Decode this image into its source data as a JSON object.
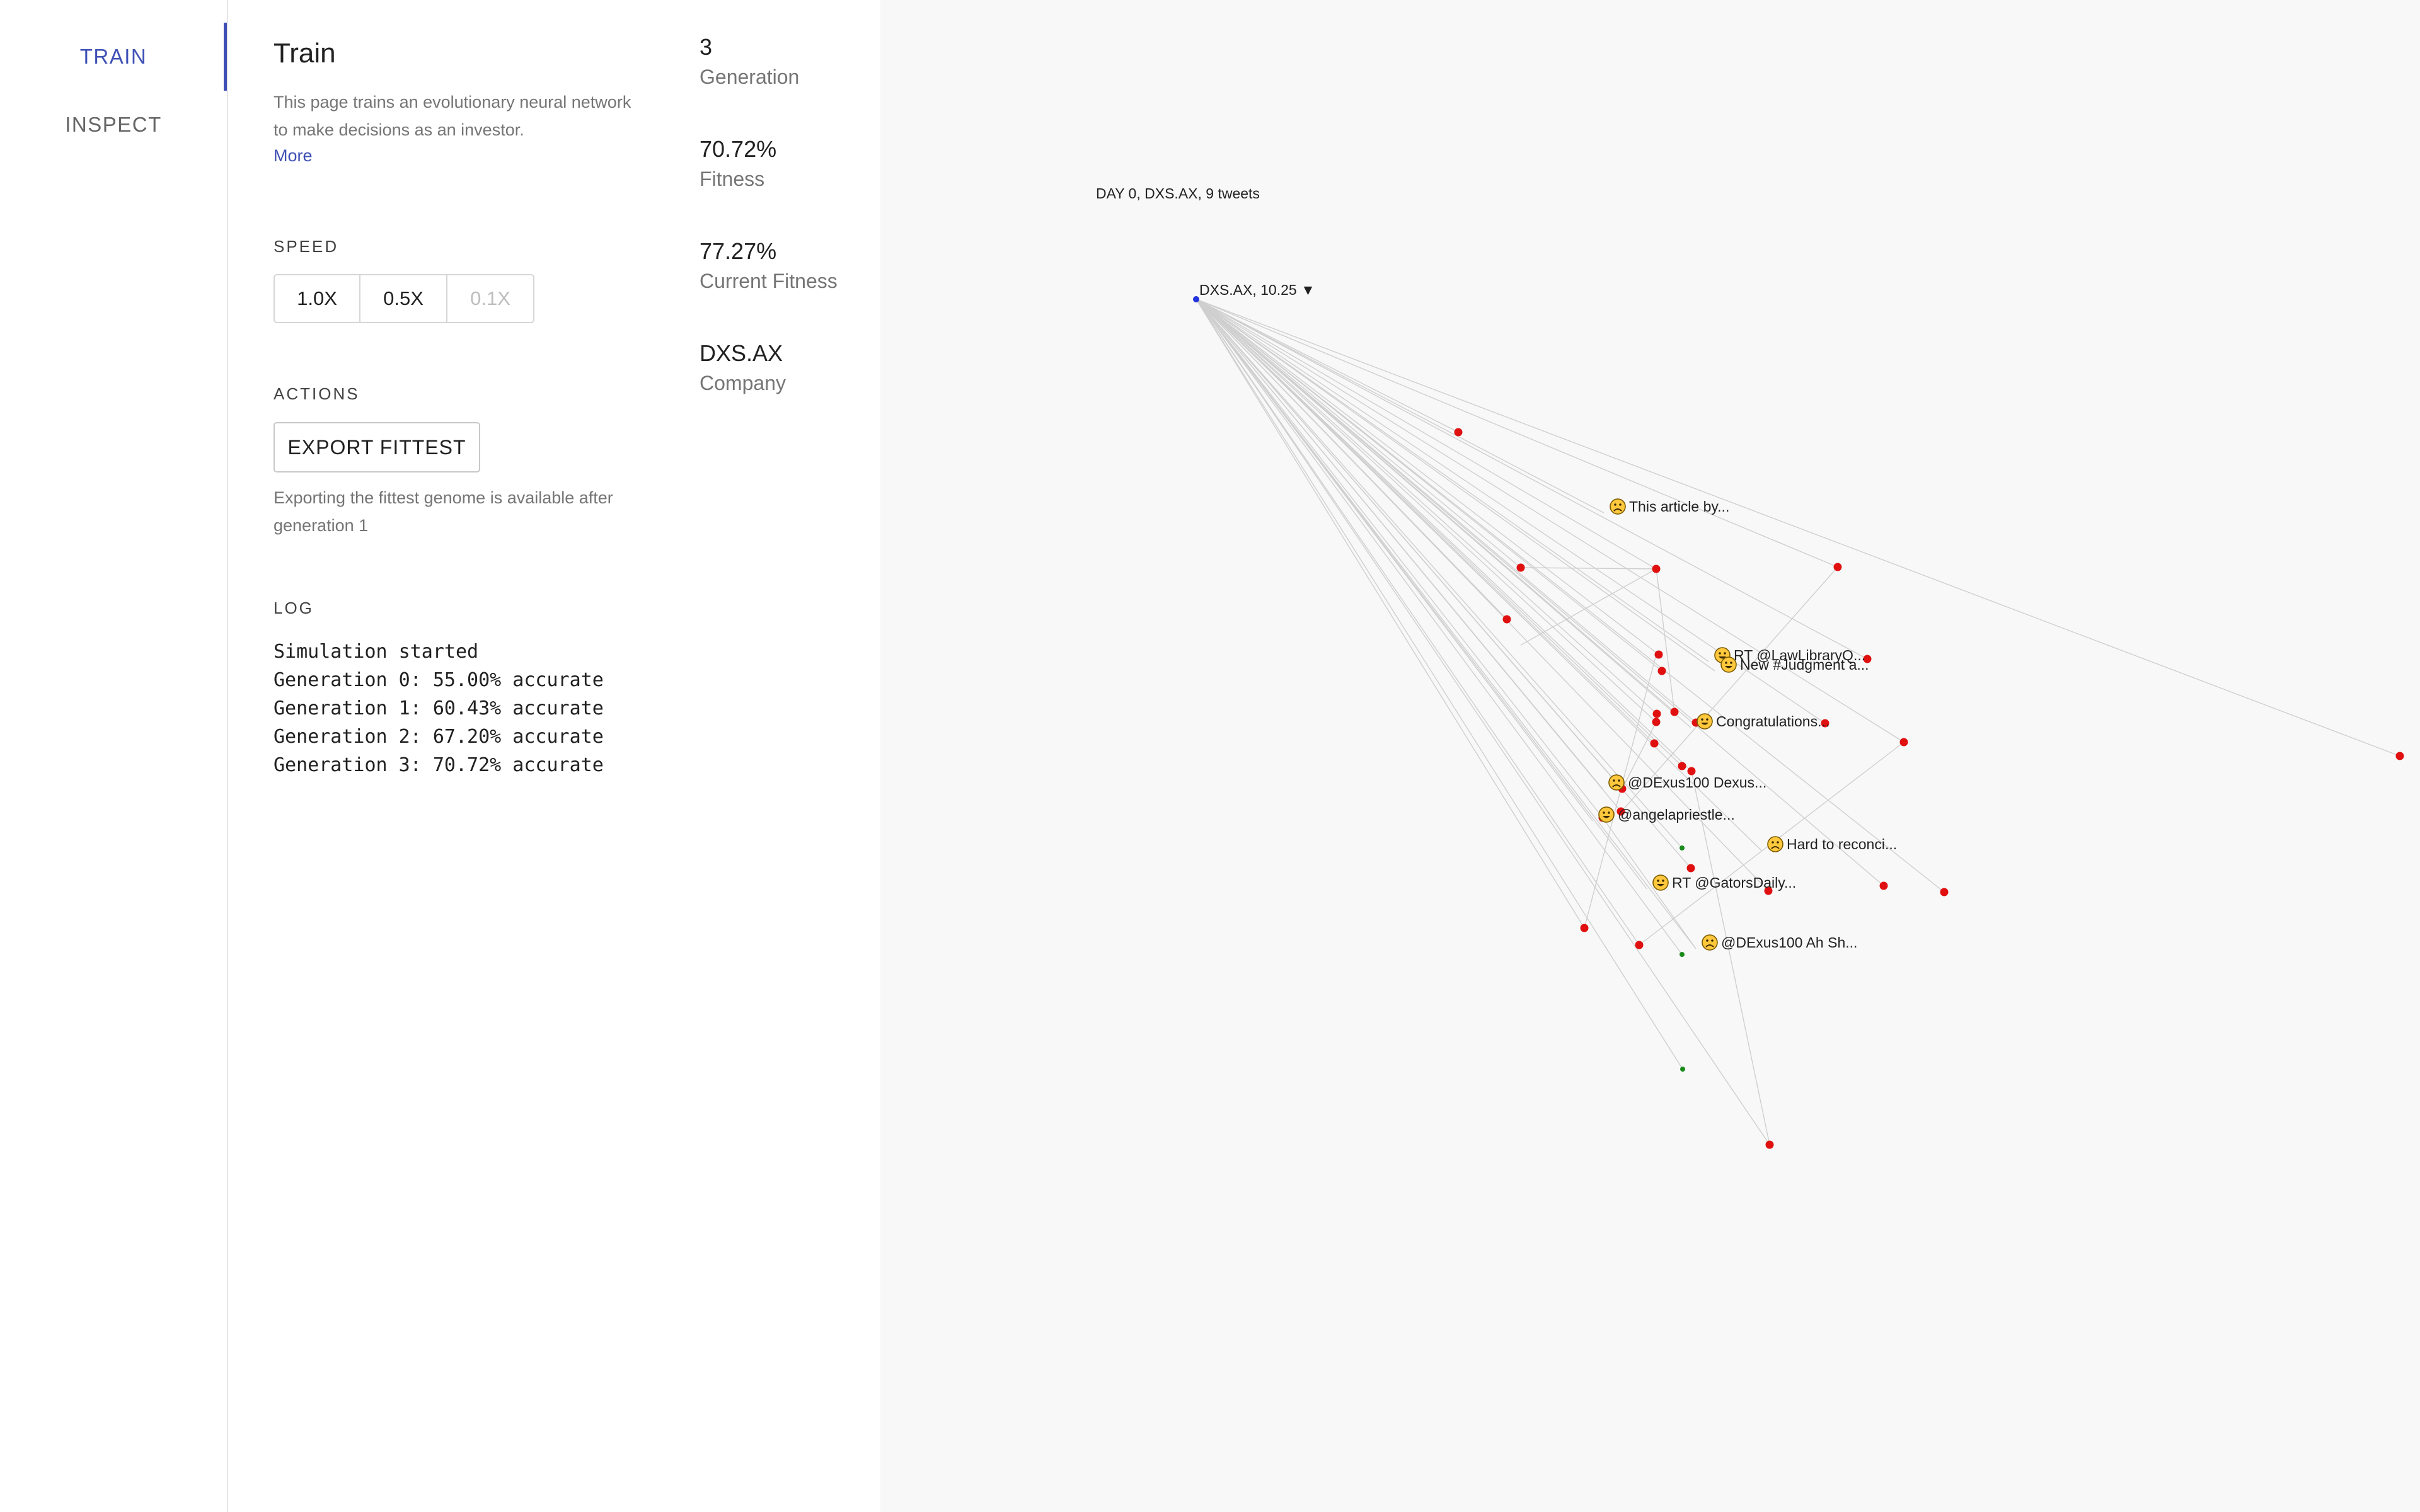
{
  "nav": {
    "train": "TRAIN",
    "inspect": "INSPECT"
  },
  "panel": {
    "title": "Train",
    "description": "This page trains an evolutionary neural network to make decisions as an investor.",
    "more": "More",
    "speed_label": "SPEED",
    "speed_options": [
      "1.0X",
      "0.5X",
      "0.1X"
    ],
    "actions_label": "ACTIONS",
    "export_button": "EXPORT FITTEST",
    "export_note": "Exporting the fittest genome is available after generation 1",
    "log_label": "LOG",
    "log": [
      "Simulation started",
      "Generation 0: 55.00% accurate",
      "Generation 1: 60.43% accurate",
      "Generation 2: 67.20% accurate",
      "Generation 3: 70.72% accurate"
    ]
  },
  "stats": [
    {
      "value": "3",
      "label": "Generation"
    },
    {
      "value": "70.72%",
      "label": "Fitness"
    },
    {
      "value": "77.27%",
      "label": "Current Fitness"
    },
    {
      "value": "DXS.AX",
      "label": "Company"
    }
  ],
  "graph": {
    "header": "DAY 0, DXS.AX, 9 tweets",
    "root_label": "DXS.AX, 10.25 ▼",
    "colors": {
      "root": "#2233dd",
      "negative": "#e01010",
      "positive": "#1a8a1a",
      "edge": "#cfcfcf"
    },
    "tweets": [
      {
        "label": "This article by...",
        "sentiment": "sad"
      },
      {
        "label": "RT @LawLibraryQ...",
        "sentiment": "happy"
      },
      {
        "label": "New #Judgment a...",
        "sentiment": "happy"
      },
      {
        "label": "Congratulations...",
        "sentiment": "happy"
      },
      {
        "label": "@DExus100 Dexus...",
        "sentiment": "sad"
      },
      {
        "label": "@angelapriestle...",
        "sentiment": "happy"
      },
      {
        "label": "Hard to reconci...",
        "sentiment": "sad"
      },
      {
        "label": "RT @GatorsDaily...",
        "sentiment": "happy"
      },
      {
        "label": "@DExus100 Ah Sh...",
        "sentiment": "sad"
      }
    ]
  }
}
